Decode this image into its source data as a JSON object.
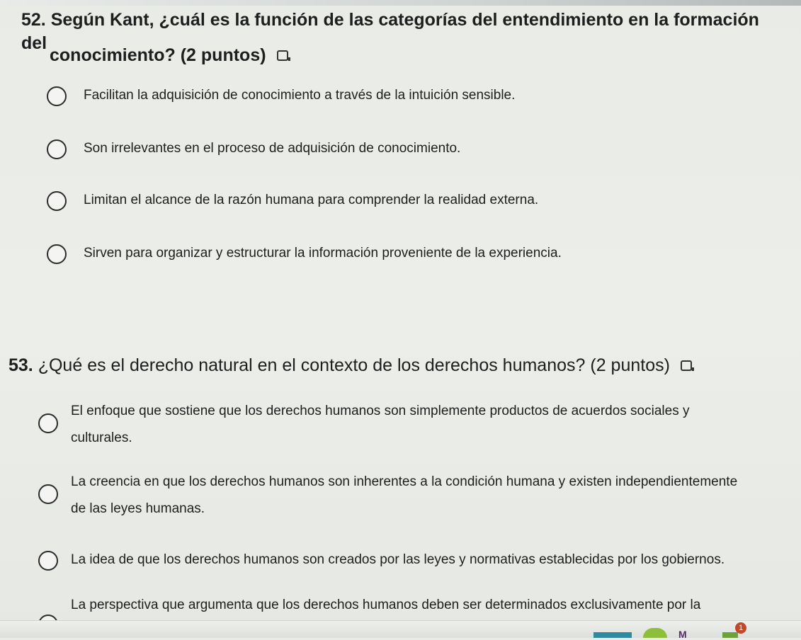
{
  "q52": {
    "number": "52.",
    "text": "Según Kant, ¿cuál es la función de las categorías del entendimiento en la formación del",
    "text2": "conocimiento? (2 puntos)",
    "options": [
      "Facilitan la adquisición de conocimiento a través de la intuición sensible.",
      "Son irrelevantes en el proceso de adquisición de conocimiento.",
      "Limitan el alcance de la razón humana para comprender la realidad externa.",
      "Sirven para organizar y estructurar la información proveniente de la experiencia."
    ]
  },
  "q53": {
    "number": "53.",
    "text": "¿Qué es el derecho natural en el contexto de los derechos humanos? (2 puntos)",
    "options": [
      {
        "line1": "El enfoque que sostiene que los derechos humanos son simplemente productos de acuerdos sociales y",
        "line2": "culturales."
      },
      {
        "line1": "La creencia en que los derechos humanos son inherentes a la condición humana y existen independientemente",
        "line2": "de las leyes humanas."
      },
      {
        "line1": "La idea de que los derechos humanos son creados por las leyes y normativas establecidas por los gobiernos.",
        "line2": ""
      },
      {
        "line1": "La perspectiva que argumenta que los derechos humanos deben ser determinados exclusivamente por la",
        "line2": ""
      }
    ]
  },
  "icons": {
    "immersive_reader": "immersive-reader-icon",
    "radio": "radio-button"
  },
  "taskbar": {
    "badge": "1"
  }
}
